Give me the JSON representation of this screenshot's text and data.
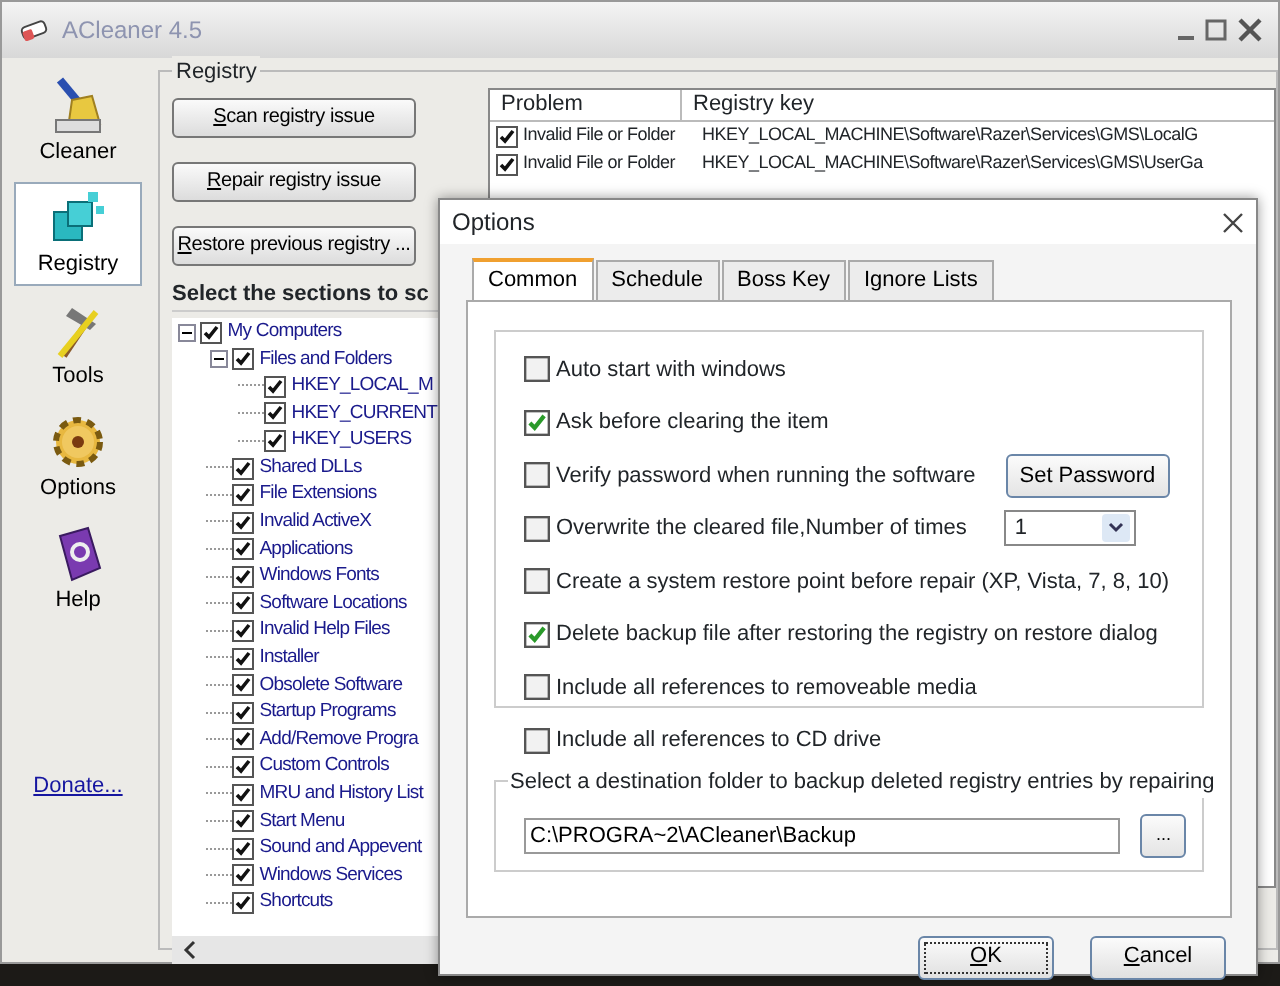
{
  "window": {
    "title": "ACleaner 4.5"
  },
  "sidebar": {
    "items": [
      {
        "label": "Cleaner",
        "selected": false
      },
      {
        "label": "Registry",
        "selected": true
      },
      {
        "label": "Tools",
        "selected": false
      },
      {
        "label": "Options",
        "selected": false
      },
      {
        "label": "Help",
        "selected": false
      }
    ],
    "donate": "Donate..."
  },
  "registry": {
    "title": "Registry",
    "buttons": [
      "Scan registry issue",
      "Repair registry issue",
      "Restore previous registry ..."
    ],
    "sections_title": "Select the sections to sc",
    "tree": [
      {
        "label": "My Computers",
        "checked": true,
        "expanded": true,
        "children": [
          {
            "label": "Files and Folders",
            "checked": true,
            "expanded": true,
            "children": [
              {
                "label": "HKEY_LOCAL_M",
                "checked": true
              },
              {
                "label": "HKEY_CURRENT",
                "checked": true
              },
              {
                "label": "HKEY_USERS",
                "checked": true
              }
            ]
          },
          {
            "label": "Shared DLLs",
            "checked": true
          },
          {
            "label": "File Extensions",
            "checked": true
          },
          {
            "label": "Invalid ActiveX",
            "checked": true
          },
          {
            "label": "Applications",
            "checked": true
          },
          {
            "label": "Windows Fonts",
            "checked": true
          },
          {
            "label": "Software Locations",
            "checked": true
          },
          {
            "label": "Invalid Help Files",
            "checked": true
          },
          {
            "label": "Installer",
            "checked": true
          },
          {
            "label": "Obsolete Software",
            "checked": true
          },
          {
            "label": "Startup Programs",
            "checked": true
          },
          {
            "label": "Add/Remove Progra",
            "checked": true
          },
          {
            "label": "Custom Controls",
            "checked": true
          },
          {
            "label": "MRU and History List",
            "checked": true
          },
          {
            "label": "Start Menu",
            "checked": true
          },
          {
            "label": "Sound and Appevent",
            "checked": true
          },
          {
            "label": "Windows Services",
            "checked": true
          },
          {
            "label": "Shortcuts",
            "checked": true
          }
        ]
      }
    ],
    "table": {
      "columns": [
        "Problem",
        "Registry key"
      ],
      "rows": [
        {
          "checked": true,
          "problem": "Invalid File or Folder",
          "key": "HKEY_LOCAL_MACHINE\\Software\\Razer\\Services\\GMS\\LocalG"
        },
        {
          "checked": true,
          "problem": "Invalid File or Folder",
          "key": "HKEY_LOCAL_MACHINE\\Software\\Razer\\Services\\GMS\\UserGa"
        }
      ]
    }
  },
  "dialog": {
    "title": "Options",
    "tabs": [
      {
        "label": "Common",
        "selected": true
      },
      {
        "label": "Schedule",
        "selected": false
      },
      {
        "label": "Boss Key",
        "selected": false
      },
      {
        "label": "Ignore Lists",
        "selected": false
      }
    ],
    "options": [
      {
        "kind": "checkbox",
        "label": "Auto start with windows",
        "checked": false
      },
      {
        "kind": "checkbox",
        "label": "Ask before clearing the item",
        "checked": true
      },
      {
        "kind": "button",
        "label": "Verify password when running the software",
        "checked": false,
        "button": "Set Password"
      },
      {
        "kind": "select",
        "label": "Overwrite the cleared file,Number of times",
        "checked": false,
        "value": "1"
      },
      {
        "kind": "checkbox",
        "label": "Create a system restore point before repair (XP, Vista, 7, 8, 10)",
        "checked": false
      },
      {
        "kind": "checkbox",
        "label": "Delete backup file after restoring the registry on restore dialog",
        "checked": true
      },
      {
        "kind": "checkbox",
        "label": "Include all references to removeable media",
        "checked": false
      },
      {
        "kind": "checkbox",
        "label": "Include all references to CD drive",
        "checked": false
      }
    ],
    "folder": {
      "legend": "Select a destination folder to backup deleted registry entries by repairing",
      "value": "C:\\PROGRA~2\\ACleaner\\Backup",
      "browse": "..."
    },
    "buttons": [
      {
        "label": "OK",
        "default": true
      },
      {
        "label": "Cancel",
        "default": false
      }
    ]
  }
}
